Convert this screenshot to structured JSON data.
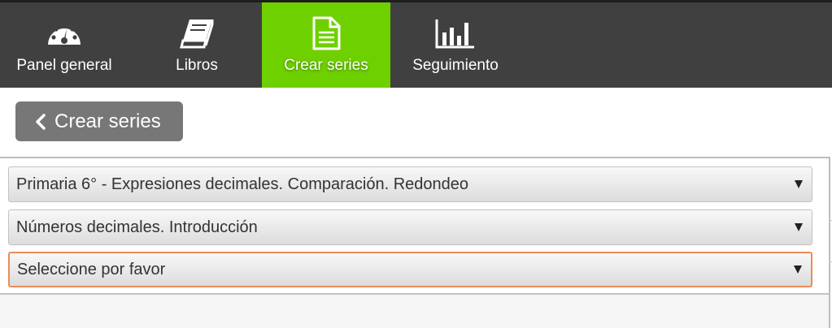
{
  "nav": {
    "items": [
      {
        "label": "Panel general",
        "icon": "dashboard-gauge-icon"
      },
      {
        "label": "Libros",
        "icon": "book-icon"
      },
      {
        "label": "Crear series",
        "icon": "document-icon",
        "active": true
      },
      {
        "label": "Seguimiento",
        "icon": "bar-chart-icon"
      }
    ]
  },
  "back_button": {
    "label": "Crear series",
    "icon": "chevron-left-icon"
  },
  "selects": [
    {
      "value": "Primaria 6° - Expresiones decimales. Comparación. Redondeo"
    },
    {
      "value": "Números decimales. Introducción"
    },
    {
      "value": "Seleccione por favor",
      "focused": true
    }
  ],
  "colors": {
    "topbar": "#404040",
    "active_tab": "#6fd000",
    "back_button": "#777777",
    "focus_border": "#ee8a5a"
  }
}
